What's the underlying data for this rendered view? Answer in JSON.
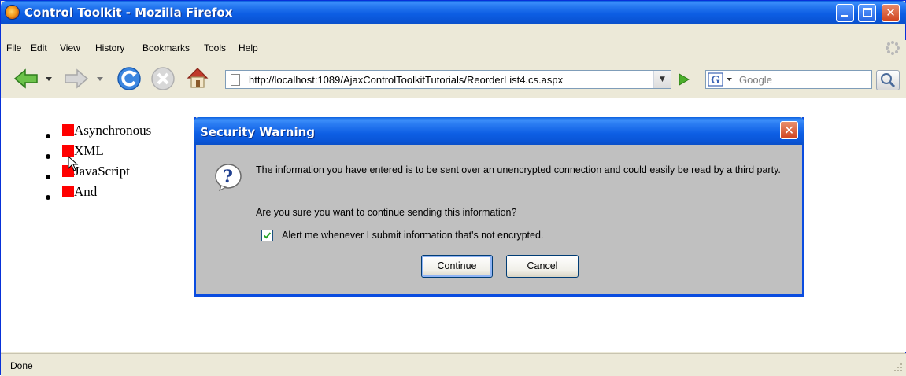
{
  "window": {
    "title": "Control Toolkit - Mozilla Firefox",
    "minimize_icon": "minimize-icon",
    "maximize_icon": "maximize-icon",
    "close_icon": "close-icon"
  },
  "menu": {
    "items": [
      "File",
      "Edit",
      "View",
      "History",
      "Bookmarks",
      "Tools",
      "Help"
    ]
  },
  "toolbar": {
    "back_icon": "back-arrow-icon",
    "forward_icon": "forward-arrow-icon",
    "reload_icon": "reload-icon",
    "stop_icon": "stop-icon",
    "home_icon": "home-icon",
    "url": "http://localhost:1089/AjaxControlToolkitTutorials/ReorderList4.cs.aspx",
    "search_placeholder": "Google",
    "search_engine_icon": "google-g-icon",
    "search_button_icon": "magnifier-icon"
  },
  "content": {
    "list_items": [
      "Asynchronous",
      "XML",
      "JavaScript",
      "And"
    ]
  },
  "dialog": {
    "title": "Security Warning",
    "icon": "question-icon",
    "message": "The information you have entered is to be sent over an unencrypted connection and could easily be read by a third party.",
    "question": "Are you sure you want to continue sending this information?",
    "checkbox_label": "Alert me whenever I submit information that's not encrypted.",
    "checkbox_checked": true,
    "continue_label": "Continue",
    "cancel_label": "Cancel"
  },
  "status": {
    "text": "Done"
  },
  "colors": {
    "titlebar_blue": "#0a5fde",
    "handle_red": "#ff0000",
    "dialog_gray": "#c0c0c0",
    "chrome_beige": "#ece9d8"
  }
}
